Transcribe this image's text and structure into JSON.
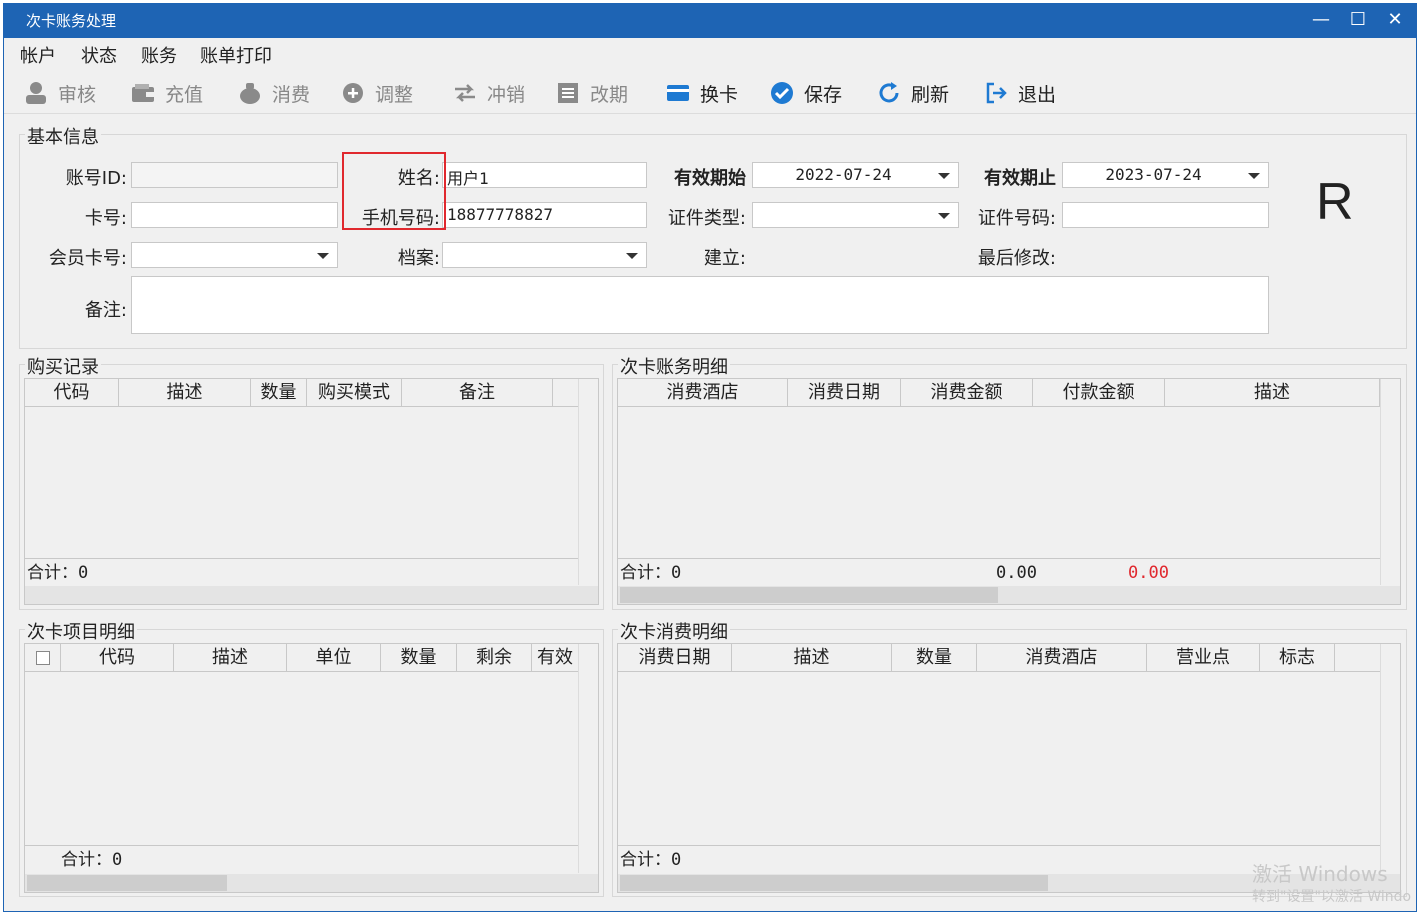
{
  "window": {
    "title": "次卡账务处理",
    "minimize": "—",
    "maximize": "☐",
    "close": "✕"
  },
  "menu": [
    "帐户",
    "状态",
    "账务",
    "账单打印"
  ],
  "toolbar": [
    {
      "label": "审核",
      "icon": "user-icon",
      "enabled": false
    },
    {
      "label": "充值",
      "icon": "wallet-icon",
      "enabled": false
    },
    {
      "label": "消费",
      "icon": "money-bag-icon",
      "enabled": false
    },
    {
      "label": "调整",
      "icon": "plus-circle-icon",
      "enabled": false
    },
    {
      "label": "冲销",
      "icon": "swap-arrows-icon",
      "enabled": false
    },
    {
      "label": "改期",
      "icon": "calendar-list-icon",
      "enabled": false
    },
    {
      "label": "换卡",
      "icon": "card-icon",
      "enabled": true
    },
    {
      "label": "保存",
      "icon": "check-circle-icon",
      "enabled": true
    },
    {
      "label": "刷新",
      "icon": "refresh-icon",
      "enabled": true
    },
    {
      "label": "退出",
      "icon": "exit-icon",
      "enabled": true
    }
  ],
  "basic": {
    "group_title": "基本信息",
    "account_id_label": "账号ID:",
    "account_id_value": "",
    "name_label": "姓名:",
    "name_value": "用户1",
    "valid_from_label": "有效期始",
    "valid_from_value": "2022-07-24",
    "valid_to_label": "有效期止",
    "valid_to_value": "2023-07-24",
    "card_no_label": "卡号:",
    "card_no_value": "",
    "phone_label": "手机号码:",
    "phone_value": "18877778827",
    "id_type_label": "证件类型:",
    "id_type_value": "",
    "id_no_label": "证件号码:",
    "id_no_value": "",
    "member_card_label": "会员卡号:",
    "member_card_value": "",
    "archive_label": "档案:",
    "archive_value": "",
    "created_label": "建立:",
    "modified_label": "最后修改:",
    "remark_label": "备注:",
    "remark_value": "",
    "status_letter": "R"
  },
  "purchase": {
    "group_title": "购买记录",
    "columns": [
      "代码",
      "描述",
      "数量",
      "购买模式",
      "备注"
    ],
    "footer": "合计：0"
  },
  "ledger": {
    "group_title": "次卡账务明细",
    "columns": [
      "消费酒店",
      "消费日期",
      "消费金额",
      "付款金额",
      "描述"
    ],
    "footer": "合计：0",
    "total_consume": "0.00",
    "total_pay": "0.00",
    "pay_color": "#e0282e"
  },
  "items": {
    "group_title": "次卡项目明细",
    "columns": [
      "代码",
      "描述",
      "单位",
      "数量",
      "剩余",
      "有效"
    ],
    "footer": "合计：0"
  },
  "consume": {
    "group_title": "次卡消费明细",
    "columns": [
      "消费日期",
      "描述",
      "数量",
      "消费酒店",
      "营业点",
      "标志"
    ],
    "footer": "合计：0"
  },
  "watermark": {
    "line1": "激活 Windows",
    "line2": "转到\"设置\"以激活 Windo"
  }
}
